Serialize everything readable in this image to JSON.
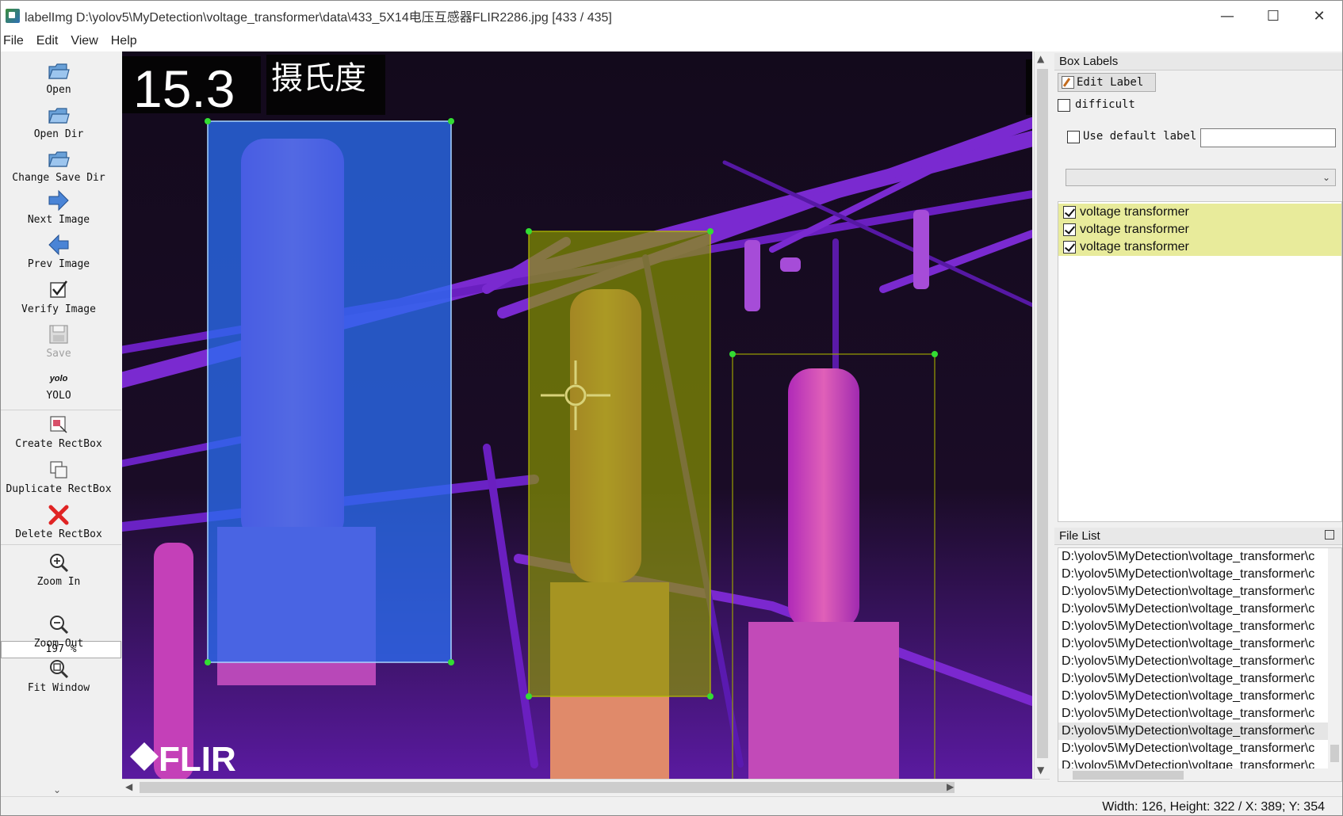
{
  "window": {
    "title": "labelImg D:\\yolov5\\MyDetection\\voltage_transformer\\data\\433_5X14电压互感器FLIR2286.jpg [433 / 435]",
    "minimize_glyph": "—",
    "maximize_glyph": "☐",
    "close_glyph": "✕"
  },
  "menu": [
    "File",
    "Edit",
    "View",
    "Help"
  ],
  "toolbar": {
    "open": "Open",
    "open_dir": "Open Dir",
    "change_save_dir": "Change Save Dir",
    "next_image": "Next Image",
    "prev_image": "Prev Image",
    "verify_image": "Verify Image",
    "save": "Save",
    "yolo_icon_text": "yolo",
    "yolo": "YOLO",
    "create_rectbox": "Create RectBox",
    "duplicate_rectbox": "Duplicate RectBox",
    "delete_rectbox": "Delete RectBox",
    "zoom_in": "Zoom In",
    "zoom_value": "197 %",
    "zoom_out": "Zoom Out",
    "fit_window": "Fit Window",
    "more": "⌄"
  },
  "image_overlay": {
    "temperature": "15.3",
    "unit": "摄氏度",
    "brand": "FLIR"
  },
  "box_labels": {
    "title": "Box Labels",
    "edit_label": "Edit Label",
    "difficult": "difficult",
    "use_default_label": "Use default label",
    "default_label_value": "",
    "labels": [
      "voltage transformer",
      "voltage transformer",
      "voltage transformer"
    ]
  },
  "file_list": {
    "title": "File List",
    "items": [
      "D:\\yolov5\\MyDetection\\voltage_transformer\\c",
      "D:\\yolov5\\MyDetection\\voltage_transformer\\c",
      "D:\\yolov5\\MyDetection\\voltage_transformer\\c",
      "D:\\yolov5\\MyDetection\\voltage_transformer\\c",
      "D:\\yolov5\\MyDetection\\voltage_transformer\\c",
      "D:\\yolov5\\MyDetection\\voltage_transformer\\c",
      "D:\\yolov5\\MyDetection\\voltage_transformer\\c",
      "D:\\yolov5\\MyDetection\\voltage_transformer\\c",
      "D:\\yolov5\\MyDetection\\voltage_transformer\\c",
      "D:\\yolov5\\MyDetection\\voltage_transformer\\c",
      "D:\\yolov5\\MyDetection\\voltage_transformer\\c",
      "D:\\yolov5\\MyDetection\\voltage_transformer\\c",
      "D:\\yolov5\\MyDetection\\voltage_transformer\\c"
    ],
    "selected_index": 10
  },
  "status": "Width: 126, Height: 322 / X: 389; Y: 354",
  "colors": {
    "label_highlight": "#e8eb9b",
    "box_blue": "#2a6cf0",
    "box_olive": "#8a9a00",
    "handle_green": "#33dd33"
  }
}
